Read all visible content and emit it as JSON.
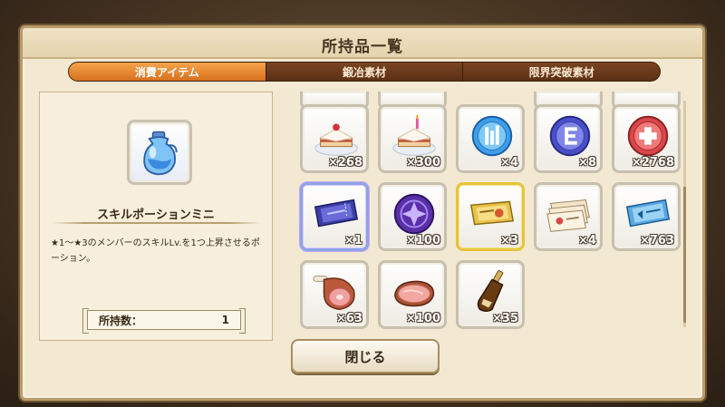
{
  "header": {
    "title": "所持品一覧"
  },
  "tabs": [
    {
      "label": "消費アイテム",
      "active": true
    },
    {
      "label": "鍛冶素材",
      "active": false
    },
    {
      "label": "限界突破素材",
      "active": false
    }
  ],
  "detail": {
    "icon": "potion-icon",
    "name": "スキルポーションミニ",
    "description": "★1～★3のメンバーのスキルLv.を1つ上昇させるポーション。",
    "owned_label": "所持数：",
    "owned_value": "1"
  },
  "items": [
    {
      "icon": "cake-slice-icon",
      "count": "×268"
    },
    {
      "icon": "cake-slice-candle-icon",
      "count": "×300"
    },
    {
      "icon": "blue-coin-icon",
      "count": "×4"
    },
    {
      "icon": "purple-coin-icon",
      "count": "×8"
    },
    {
      "icon": "red-coin-icon",
      "count": "×2768"
    },
    {
      "icon": "blue-ticket-icon",
      "count": "×1"
    },
    {
      "icon": "purple-medal-icon",
      "count": "×100"
    },
    {
      "icon": "gold-ticket-icon",
      "count": "×3"
    },
    {
      "icon": "ticket-stack-icon",
      "count": "×4"
    },
    {
      "icon": "blue-pass-ticket-icon",
      "count": "×763"
    },
    {
      "icon": "ham-bone-icon",
      "count": "×63"
    },
    {
      "icon": "ham-slice-icon",
      "count": "×100"
    },
    {
      "icon": "bottle-icon",
      "count": "×35"
    }
  ],
  "close_label": "閉じる",
  "colors": {
    "tab_active": "#e88a30",
    "tab_bar": "#6a3a1b",
    "panel": "#f3e9d2"
  }
}
